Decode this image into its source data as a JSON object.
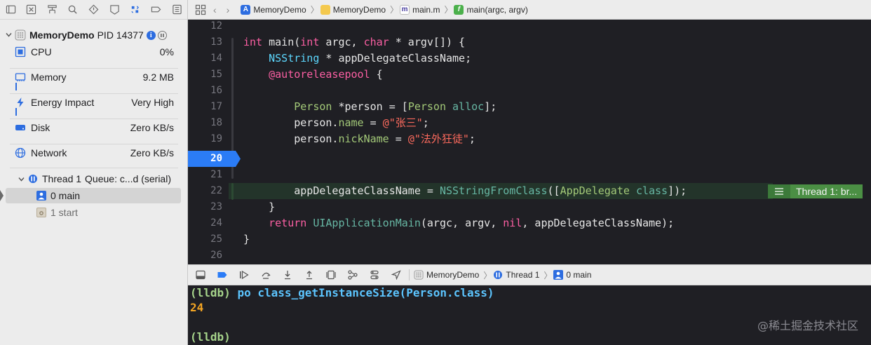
{
  "navigator": {
    "process": {
      "name": "MemoryDemo",
      "pid": "PID 14377",
      "info_icon": "i"
    },
    "gauges": [
      {
        "label": "CPU",
        "value": "0%",
        "icon": "cpu-icon"
      },
      {
        "label": "Memory",
        "value": "9.2 MB",
        "icon": "memory-icon"
      },
      {
        "label": "Energy Impact",
        "value": "Very High",
        "icon": "bolt-icon"
      },
      {
        "label": "Disk",
        "value": "Zero KB/s",
        "icon": "disk-icon"
      },
      {
        "label": "Network",
        "value": "Zero KB/s",
        "icon": "globe-icon"
      }
    ],
    "thread": {
      "label": "Thread 1",
      "queue": "Queue: c...d (serial)"
    },
    "frames": [
      {
        "label": "0 main",
        "selected": true
      },
      {
        "label": "1 start",
        "selected": false
      }
    ]
  },
  "jumpbar": {
    "crumbs": [
      "MemoryDemo",
      "MemoryDemo",
      "main.m",
      "main(argc, argv)"
    ]
  },
  "editor": {
    "line_numbers": [
      "12",
      "13",
      "14",
      "15",
      "16",
      "17",
      "18",
      "19",
      "20",
      "21",
      "22",
      "23",
      "24",
      "25",
      "26"
    ],
    "current_line": "20",
    "thread_badge": "Thread 1: br..."
  },
  "debugbar": {
    "crumbs": [
      "MemoryDemo",
      "Thread 1",
      "0 main"
    ]
  },
  "console": {
    "prompt": "(lldb)",
    "command": "po class_getInstanceSize(Person.class)",
    "output": "24",
    "watermark": "@稀土掘金技术社区"
  },
  "colors": {
    "accent": "#2d6de0",
    "breakpoint": "#2b7cf6",
    "keyword": "#fc5fa3",
    "string": "#fc6a5d",
    "class": "#a3c978",
    "console_output": "#f5a623",
    "thread_badge": "#4b8f44"
  }
}
